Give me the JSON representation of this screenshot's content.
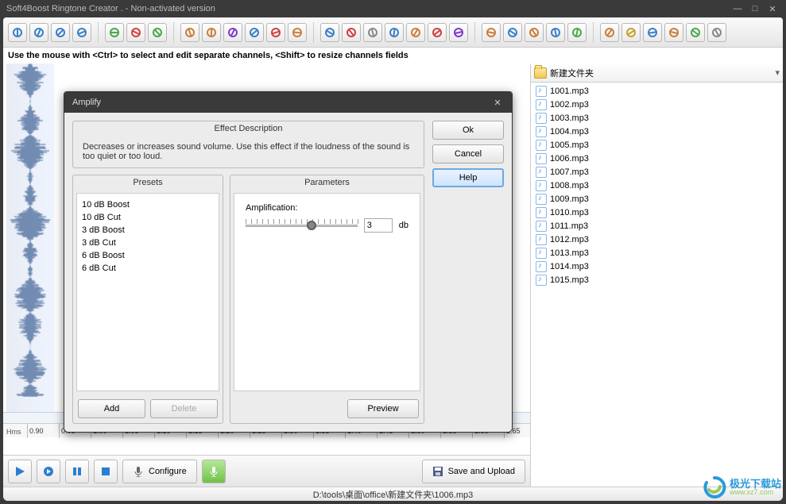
{
  "window": {
    "title": "Soft4Boost Ringtone Creator . - Non-activated version"
  },
  "hint": "Use the mouse with <Ctrl> to select and edit separate channels, <Shift> to resize channels fields",
  "ruler": {
    "label": "Hms",
    "ticks": [
      "0.90",
      "0.95",
      "1.00",
      "1.05",
      "1.10",
      "1.15",
      "1.20",
      "1.25",
      "1.30",
      "1.35",
      "1.40",
      "1.45",
      "1.50",
      "1.55",
      "1.60",
      "1.65"
    ]
  },
  "playbar": {
    "configure": "Configure",
    "saveupload": "Save and Upload"
  },
  "folder": {
    "name": "新建文件夹"
  },
  "files": [
    "1001.mp3",
    "1002.mp3",
    "1003.mp3",
    "1004.mp3",
    "1005.mp3",
    "1006.mp3",
    "1007.mp3",
    "1008.mp3",
    "1009.mp3",
    "1010.mp3",
    "1011.mp3",
    "1012.mp3",
    "1013.mp3",
    "1014.mp3",
    "1015.mp3"
  ],
  "status": {
    "path": "D:\\tools\\桌面\\office\\新建文件夹\\1006.mp3"
  },
  "dialog": {
    "title": "Amplify",
    "ok": "Ok",
    "cancel": "Cancel",
    "help": "Help",
    "effdesc_title": "Effect Description",
    "effdesc_text": "Decreases or increases sound volume. Use this effect if the loudness of the sound is too quiet or too loud.",
    "presets_title": "Presets",
    "params_title": "Parameters",
    "presets": [
      "10 dB Boost",
      "10 dB Cut",
      "3 dB Boost",
      "3 dB Cut",
      "6 dB Boost",
      "6 dB Cut"
    ],
    "amplification_label": "Amplification:",
    "amplification_value": "3",
    "amplification_unit": "db",
    "add": "Add",
    "delete": "Delete",
    "preview": "Preview"
  },
  "watermark": {
    "cn": "极光下载站",
    "en": "www.xz7.com"
  },
  "icons": {
    "toolbar": [
      "zoom-in",
      "zoom-out",
      "zoom-sel",
      "zoom-100",
      "undo",
      "delete",
      "redo",
      "fade-in",
      "fade-out",
      "normalize",
      "reverse",
      "play-sel",
      "voice",
      "player",
      "plus",
      "filters",
      "convert",
      "fx1",
      "magnet",
      "eq1",
      "eq2",
      "monitor",
      "theme1",
      "theme2",
      "panel",
      "pencil",
      "key",
      "cd",
      "palette",
      "refresh",
      "gear"
    ]
  }
}
